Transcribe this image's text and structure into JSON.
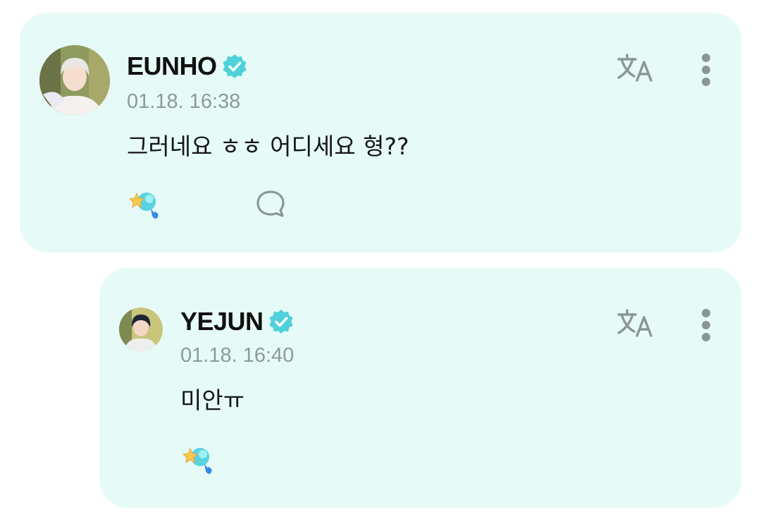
{
  "comments": [
    {
      "username": "EUNHO",
      "timestamp": "01.18. 16:38",
      "message": "그러네요 ㅎㅎ 어디세요 형??",
      "avatar": "avatar-eunho"
    },
    {
      "username": "YEJUN",
      "timestamp": "01.18. 16:40",
      "message": "미안ㅠ",
      "avatar": "avatar-yejun"
    }
  ],
  "icons": {
    "verified": "verified-badge-icon",
    "translate": "translate-icon",
    "more": "more-vertical-icon",
    "reaction": "star-sparkle-reaction-icon",
    "comment": "speech-bubble-icon"
  },
  "colors": {
    "card_background": "#e6fbf7",
    "verified_badge": "#4fd1d9",
    "icon_gray": "#8a9695",
    "timestamp_gray": "#8e9998"
  }
}
